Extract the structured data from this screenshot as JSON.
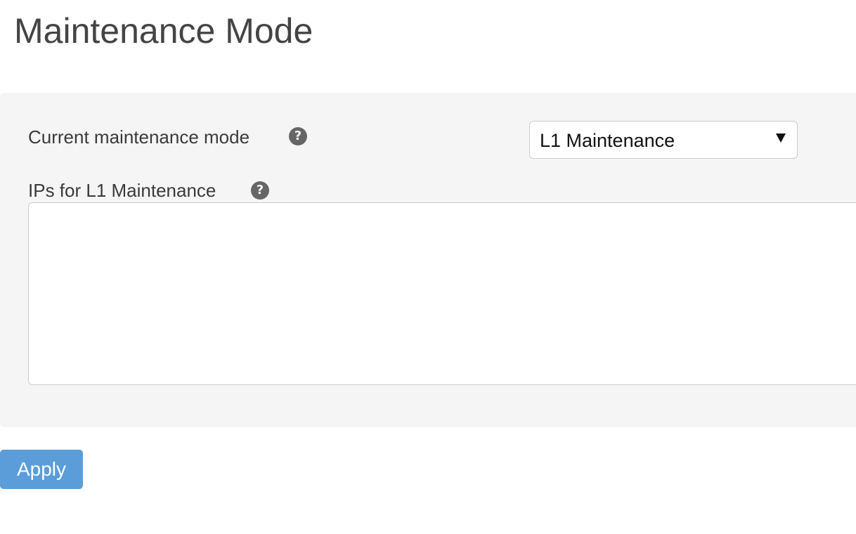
{
  "page": {
    "title": "Maintenance Mode"
  },
  "form": {
    "mode_label": "Current maintenance mode",
    "mode_help_icon": "question-circle-icon",
    "mode_select": {
      "selected_value": "L1 Maintenance",
      "arrow_icon": "triangle-down-icon"
    },
    "ips_label": "IPs for L1 Maintenance",
    "ips_help_icon": "question-circle-icon",
    "ips_value": ""
  },
  "actions": {
    "apply_label": "Apply"
  },
  "colors": {
    "panel_background": "#f5f5f5",
    "help_icon": "#666666",
    "apply_button": "#5b9dd9",
    "apply_text": "#ffffff"
  }
}
